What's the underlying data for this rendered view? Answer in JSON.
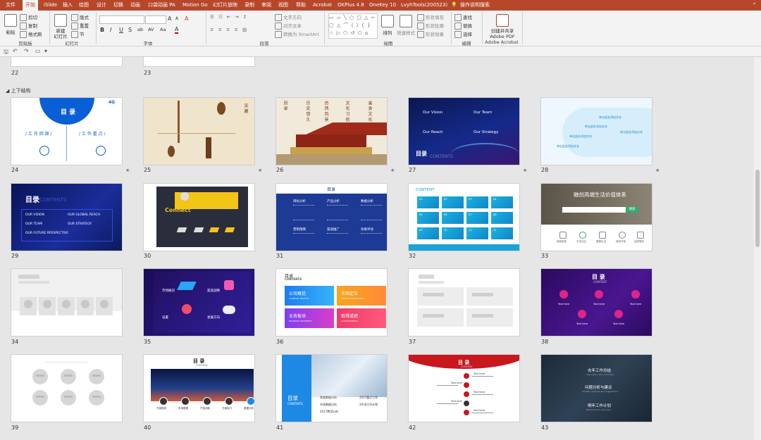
{
  "tabs": [
    "文件",
    "开始",
    "iSlide",
    "插入",
    "绘图",
    "设计",
    "切换",
    "动画",
    "口袋动画 PA",
    "Motion Go",
    "幻灯片放映",
    "录制",
    "审阅",
    "视图",
    "帮助",
    "Acrobat",
    "OKPlus 4.8",
    "OneKey 10",
    "LvyhTools(200523)",
    "操作说明搜索"
  ],
  "active_tab": "开始",
  "ribbon": {
    "clipboard": {
      "paste": "粘贴",
      "cut": "剪切",
      "copy": "复制",
      "format_painter": "格式刷",
      "group": "剪贴板"
    },
    "slides": {
      "new_slide": "新建\n幻灯片",
      "layout": "版式",
      "reset": "重置",
      "section": "节",
      "group": "幻灯片"
    },
    "font": {
      "group": "字体",
      "bold": "B",
      "italic": "I",
      "underline": "U",
      "strike": "S",
      "shadow": "ab",
      "spacing": "AV",
      "case": "Aa",
      "size_up": "A",
      "size_down": "A",
      "clear": "A"
    },
    "paragraph": {
      "text_direction": "文字方向",
      "align_text": "对齐文本",
      "smartart": "转换为 SmartArt",
      "group": "段落"
    },
    "drawing": {
      "arrange": "排列",
      "quick_styles": "快速样式",
      "shape_fill": "形状填充",
      "shape_outline": "形状轮廓",
      "shape_effects": "形状效果",
      "group": "绘图"
    },
    "editing": {
      "find": "查找",
      "replace": "替换",
      "select": "选择",
      "group": "编辑"
    },
    "acrobat": {
      "create_pdf": "创建并共享\nAdobe PDF",
      "group": "Adobe Acrobat"
    }
  },
  "section": {
    "name": "上下结构"
  },
  "prev_row": [
    "22",
    "23"
  ],
  "slides": [
    {
      "num": "24",
      "title": "目 录",
      "items": [
        "/ 工 作 回 顾 /",
        "/ 工 作 重 点 /"
      ],
      "badge": "4G"
    },
    {
      "num": "25",
      "vert": "宋 藏",
      "title": ""
    },
    {
      "num": "26",
      "cols": [
        "目 录",
        "历 史 悠 久",
        "自 然 风 景",
        "文 化 习 俗",
        "美 食 文 化"
      ]
    },
    {
      "num": "27",
      "items": [
        "Our Vision",
        "Our Team",
        "Our Reach",
        "Our Strategy"
      ],
      "title": "目录",
      "sub": "CONTENTS"
    },
    {
      "num": "28",
      "items": [
        "单击此处添加文本",
        "单击此处添加文本",
        "单击此处添加文本",
        "单击此处添加文本",
        "单击此处添加文本"
      ]
    },
    {
      "num": "29",
      "title": "目录",
      "sub": "CONTENTS",
      "items": [
        "OUR VISION",
        "OUR GLOBAL REACH",
        "OUR TEAM",
        "OUR STRATEGY",
        "OUR FUTURE PERSPECTIVE"
      ]
    },
    {
      "num": "30",
      "title": "Connect"
    },
    {
      "num": "31",
      "title": "目录",
      "cols": [
        "目标分析",
        "产品分析",
        "数据分析",
        "营销策略",
        "渠道推广",
        "效果评估"
      ]
    },
    {
      "num": "32",
      "title": "CONTENT",
      "items": [
        "01",
        "02",
        "03",
        "04",
        "05",
        "06",
        "07",
        "08",
        "09",
        "10",
        "11",
        "12"
      ]
    },
    {
      "num": "33",
      "title": "融创高端生活价值体系",
      "btn": "搜索",
      "icons": [
        "智能家居",
        "平安社区",
        "健康生活",
        "绿色环保",
        "品质服务"
      ]
    },
    {
      "num": "34"
    },
    {
      "num": "35",
      "items": [
        "市场概况",
        "渠道战略",
        "设置",
        "发展方向"
      ]
    },
    {
      "num": "36",
      "title": "目录",
      "sub": "CONTENTS",
      "items": [
        "公司概括",
        "市场定位",
        "业务板块",
        "取得成绩"
      ],
      "subs": [
        "COMPANY PROFILE",
        "MARKET POSITIONING",
        "BUSINESS SEGMENTS",
        "ACHIEVEMENTS"
      ]
    },
    {
      "num": "37"
    },
    {
      "num": "38",
      "title": "目 录",
      "sub": "CONTENT",
      "items": [
        "Text here",
        "Text here",
        "Text here",
        "Text here",
        "Text here"
      ]
    },
    {
      "num": "39"
    },
    {
      "num": "40",
      "title": "目 录",
      "sub": "CONTENT",
      "items": [
        "方案规划",
        "市场数据",
        "产品创新",
        "方案执行",
        "数据分析"
      ]
    },
    {
      "num": "41",
      "title": "目录",
      "sub": "CONTENTS",
      "items": [
        "季度数据分析",
        "2017重点工作",
        "市场数据分析",
        "2018工作计划",
        "2017费用分析"
      ]
    },
    {
      "num": "42",
      "title": "目 录",
      "sub": "CONTENT",
      "items": [
        "Text here",
        "Text here",
        "Text here",
        "Text here",
        "Text here"
      ]
    },
    {
      "num": "43",
      "items": [
        "去年工作总结",
        "问题分析与建议",
        "明年工作计划"
      ],
      "subs": [
        "Last year's work summary",
        "Problem analysis and suggestions",
        "Work plan for next year"
      ]
    }
  ],
  "starred": [
    "24",
    "25",
    "26",
    "27",
    "28"
  ],
  "colors": {
    "accent": "#b7472a",
    "blue": "#0a5fd6",
    "navy": "#0d1a5c",
    "red": "#c9171e",
    "purple": "#3a0f6e"
  }
}
